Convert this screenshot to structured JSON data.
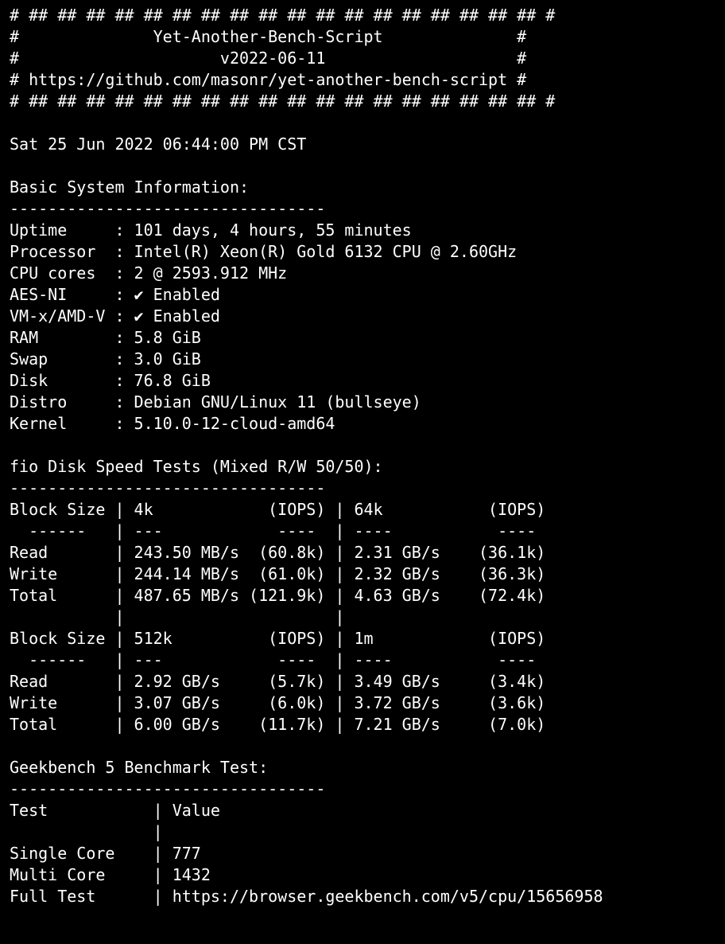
{
  "header": {
    "border_top": "# ## ## ## ## ## ## ## ## ## ## ## ## ## ## ## ## ## ## #",
    "title": "#              Yet-Another-Bench-Script              #",
    "version": "#                     v2022-06-11                    #",
    "url": "# https://github.com/masonr/yet-another-bench-script #",
    "border_bot": "# ## ## ## ## ## ## ## ## ## ## ## ## ## ## ## ## ## ## #"
  },
  "timestamp": "Sat 25 Jun 2022 06:44:00 PM CST",
  "sysinfo": {
    "heading": "Basic System Information:",
    "sep": "---------------------------------",
    "rows": {
      "uptime": "Uptime     : 101 days, 4 hours, 55 minutes",
      "processor": "Processor  : Intel(R) Xeon(R) Gold 6132 CPU @ 2.60GHz",
      "cores": "CPU cores  : 2 @ 2593.912 MHz",
      "aesni": "AES-NI     : ✔ Enabled",
      "vmx": "VM-x/AMD-V : ✔ Enabled",
      "ram": "RAM        : 5.8 GiB",
      "swap": "Swap       : 3.0 GiB",
      "disk": "Disk       : 76.8 GiB",
      "distro": "Distro     : Debian GNU/Linux 11 (bullseye)",
      "kernel": "Kernel     : 5.10.0-12-cloud-amd64"
    }
  },
  "fio": {
    "heading": "fio Disk Speed Tests (Mixed R/W 50/50):",
    "sep": "---------------------------------",
    "block1": {
      "hdr": "Block Size | 4k            (IOPS) | 64k           (IOPS)",
      "dash": "  ------   | ---            ----  | ----           ---- ",
      "read": "Read       | 243.50 MB/s  (60.8k) | 2.31 GB/s    (36.1k)",
      "write": "Write      | 244.14 MB/s  (61.0k) | 2.32 GB/s    (36.3k)",
      "total": "Total      | 487.65 MB/s (121.9k) | 4.63 GB/s    (72.4k)",
      "blank": "           |                      |                     "
    },
    "block2": {
      "hdr": "Block Size | 512k          (IOPS) | 1m            (IOPS)",
      "dash": "  ------   | ---            ----  | ----           ---- ",
      "read": "Read       | 2.92 GB/s     (5.7k) | 3.49 GB/s     (3.4k)",
      "write": "Write      | 3.07 GB/s     (6.0k) | 3.72 GB/s     (3.6k)",
      "total": "Total      | 6.00 GB/s    (11.7k) | 7.21 GB/s     (7.0k)"
    }
  },
  "geekbench": {
    "heading": "Geekbench 5 Benchmark Test:",
    "sep": "---------------------------------",
    "hdr": "Test           | Value",
    "blank": "               |",
    "single": "Single Core    | 777",
    "multi": "Multi Core     | 1432",
    "full": "Full Test      | https://browser.geekbench.com/v5/cpu/15656958"
  }
}
